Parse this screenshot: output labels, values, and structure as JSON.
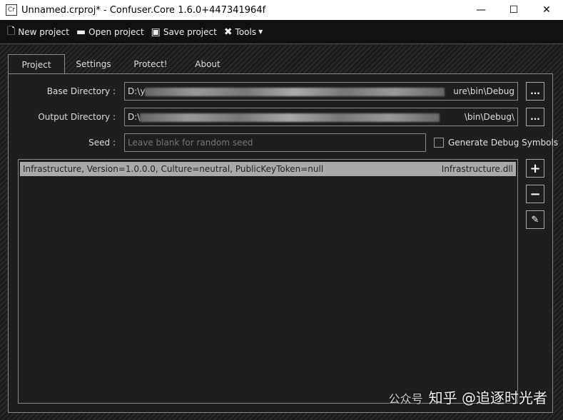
{
  "window": {
    "title": "Unnamed.crproj* - Confuser.Core 1.6.0+447341964f",
    "app_icon": "Cr",
    "minimize": "—",
    "maximize": "☐",
    "close": "✕"
  },
  "toolbar": {
    "new_project": "New project",
    "open_project": "Open project",
    "save_project": "Save project",
    "tools": "Tools"
  },
  "tabs": [
    "Project",
    "Settings",
    "Protect!",
    "About"
  ],
  "project": {
    "base_dir_label": "Base Directory :",
    "base_dir_prefix": "D:\\y",
    "base_dir_suffix": "ure\\bin\\Debug",
    "output_dir_label": "Output Directory :",
    "output_dir_prefix": "D:\\",
    "output_dir_suffix": "\\bin\\Debug\\",
    "browse_label": "...",
    "seed_label": "Seed :",
    "seed_placeholder": "Leave blank for random seed",
    "seed_value": "",
    "debug_symbols_label": "Generate Debug Symbols",
    "debug_symbols_checked": false,
    "modules": [
      {
        "name": "Infrastructure, Version=1.0.0.0, Culture=neutral, PublicKeyToken=null",
        "file": "Infrastructure.dll"
      }
    ],
    "add": "+",
    "remove": "−",
    "edit": "✎"
  },
  "watermark": {
    "text": "知乎 @追逐时光者",
    "sub": "公众号"
  }
}
